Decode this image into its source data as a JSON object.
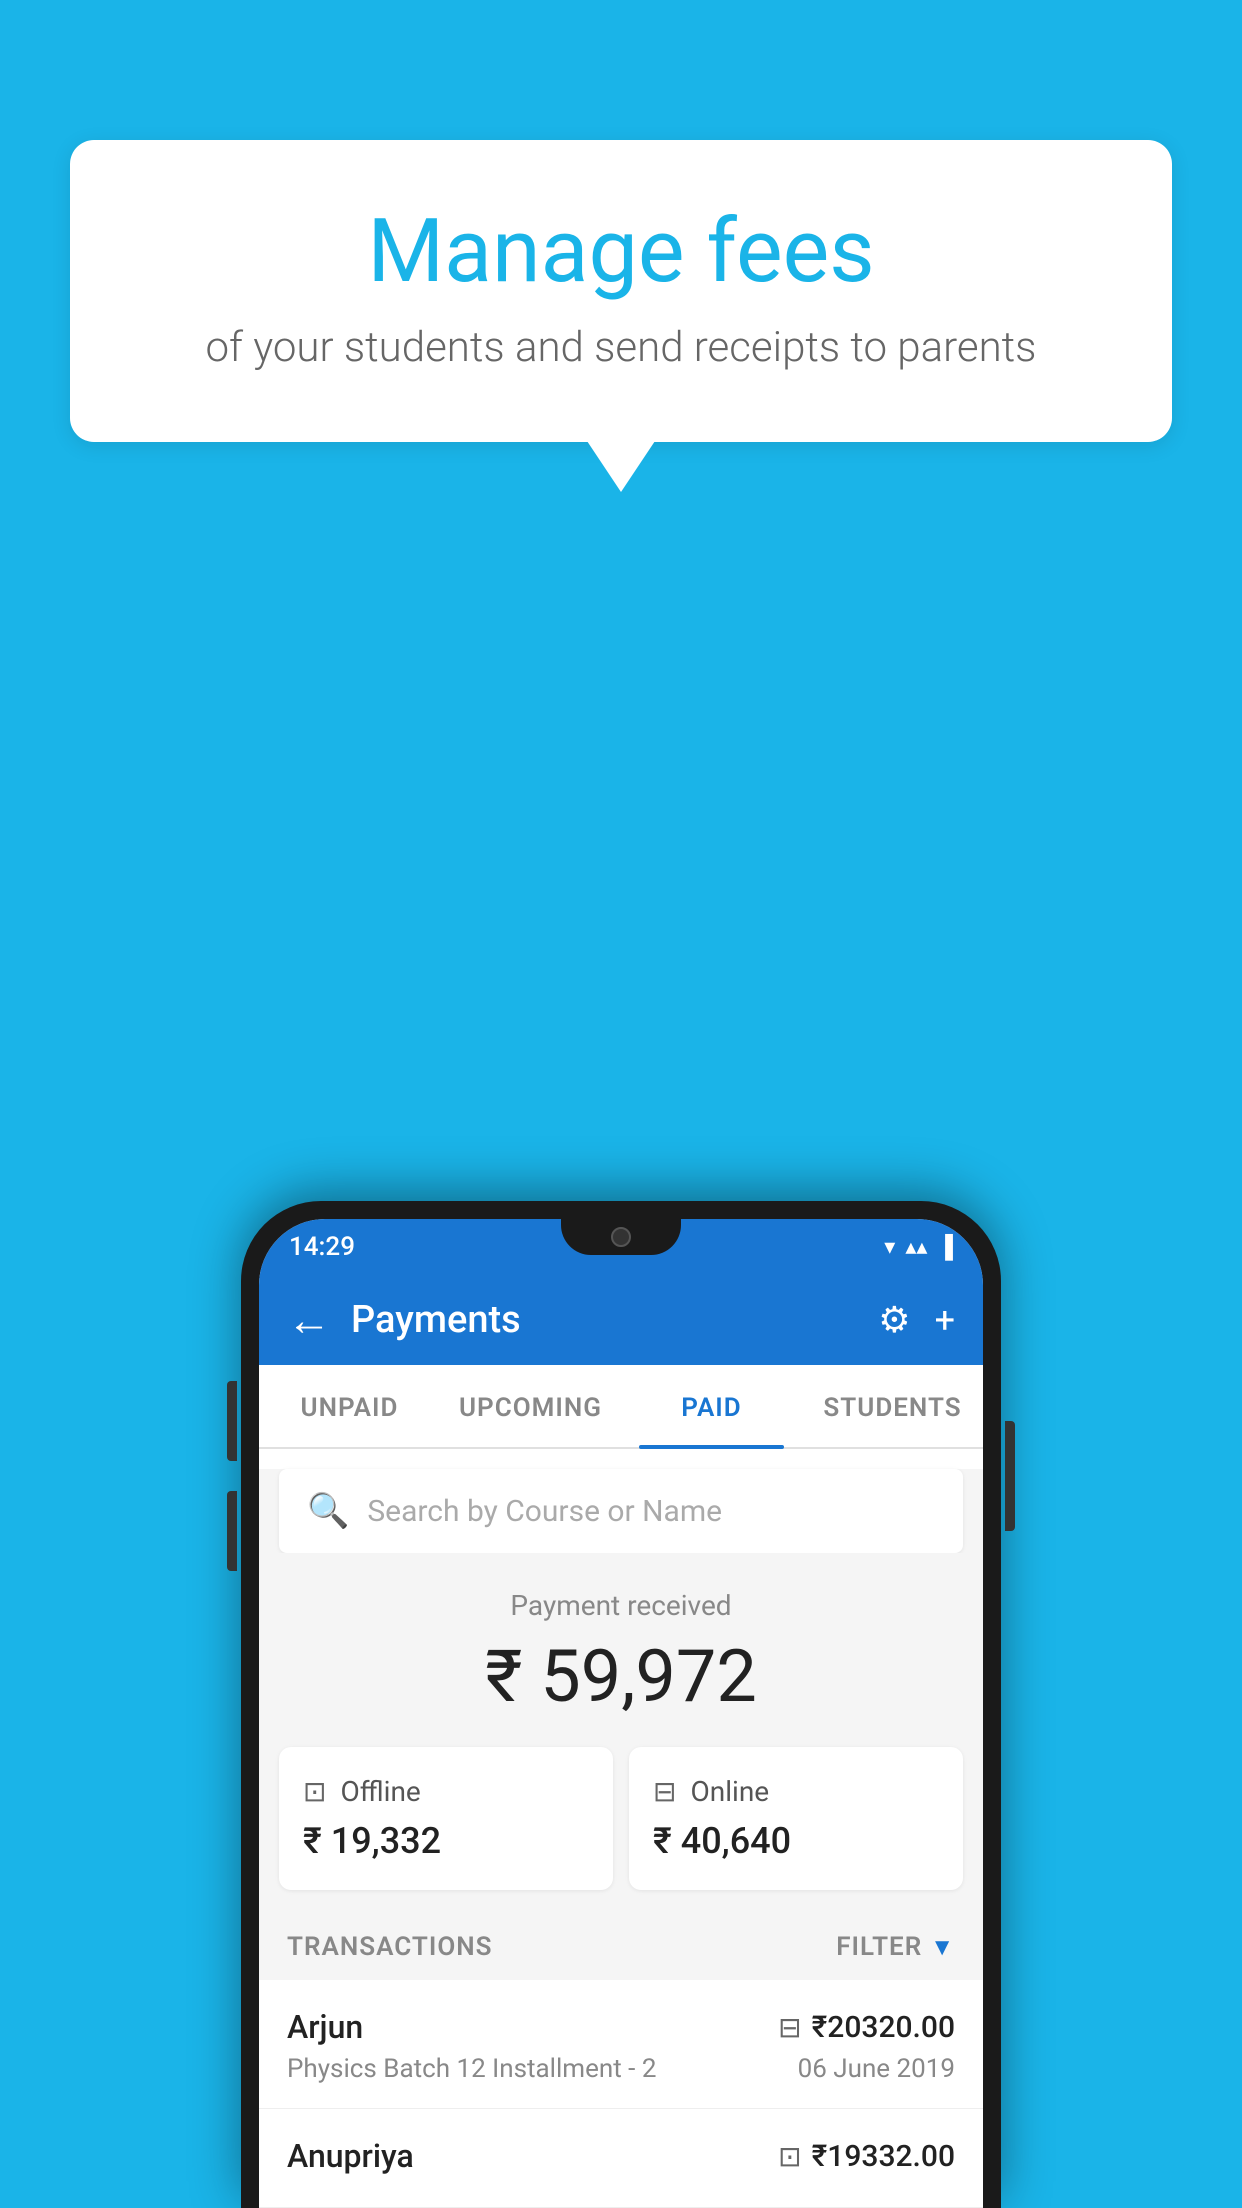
{
  "background_color": "#1ab4e8",
  "speech_bubble": {
    "title": "Manage fees",
    "subtitle": "of your students and send receipts to parents"
  },
  "status_bar": {
    "time": "14:29",
    "wifi_icon": "▼",
    "signal_icon": "▲",
    "battery_icon": "▌"
  },
  "header": {
    "title": "Payments",
    "back_label": "←",
    "settings_label": "⚙",
    "add_label": "+"
  },
  "tabs": [
    {
      "id": "unpaid",
      "label": "UNPAID",
      "active": false
    },
    {
      "id": "upcoming",
      "label": "UPCOMING",
      "active": false
    },
    {
      "id": "paid",
      "label": "PAID",
      "active": true
    },
    {
      "id": "students",
      "label": "STUDENTS",
      "active": false
    }
  ],
  "search": {
    "placeholder": "Search by Course or Name"
  },
  "payment_received": {
    "label": "Payment received",
    "amount": "₹ 59,972"
  },
  "cards": [
    {
      "type": "Offline",
      "amount": "₹ 19,332",
      "icon": "offline"
    },
    {
      "type": "Online",
      "amount": "₹ 40,640",
      "icon": "online"
    }
  ],
  "transactions_section": {
    "label": "TRANSACTIONS",
    "filter_label": "FILTER"
  },
  "transactions": [
    {
      "name": "Arjun",
      "course": "Physics Batch 12 Installment - 2",
      "amount": "₹20320.00",
      "date": "06 June 2019",
      "payment_type": "online"
    },
    {
      "name": "Anupriya",
      "course": "",
      "amount": "₹19332.00",
      "date": "",
      "payment_type": "offline"
    }
  ]
}
